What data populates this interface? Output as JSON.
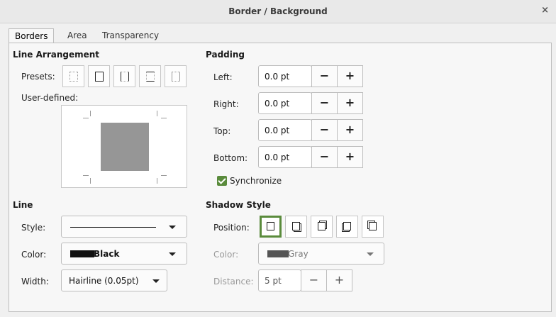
{
  "window": {
    "title": "Border / Background",
    "close_glyph": "×"
  },
  "tabs": [
    "Borders",
    "Area",
    "Transparency"
  ],
  "active_tab": "Borders",
  "line_arrangement": {
    "heading": "Line Arrangement",
    "presets_label": "Presets:",
    "user_defined_label": "User-defined:"
  },
  "padding": {
    "heading": "Padding",
    "rows": [
      {
        "label": "Left:",
        "value": "0.0 pt"
      },
      {
        "label": "Right:",
        "value": "0.0 pt"
      },
      {
        "label": "Top:",
        "value": "0.0 pt"
      },
      {
        "label": "Bottom:",
        "value": "0.0 pt"
      }
    ],
    "decrement": "−",
    "increment": "+",
    "synchronize_label": "Synchronize",
    "synchronize_checked": true
  },
  "line": {
    "heading": "Line",
    "style_label": "Style:",
    "color_label": "Color:",
    "color_value": "Black",
    "color_swatch": "#111111",
    "width_label": "Width:",
    "width_value": "Hairline (0.05pt)"
  },
  "shadow_style": {
    "heading": "Shadow Style",
    "position_label": "Position:",
    "color_label": "Color:",
    "color_value": "Gray",
    "color_swatch": "#555555",
    "distance_label": "Distance:",
    "distance_value": "5 pt",
    "decrement": "−",
    "increment": "+",
    "accent": "#5a8b3c"
  }
}
